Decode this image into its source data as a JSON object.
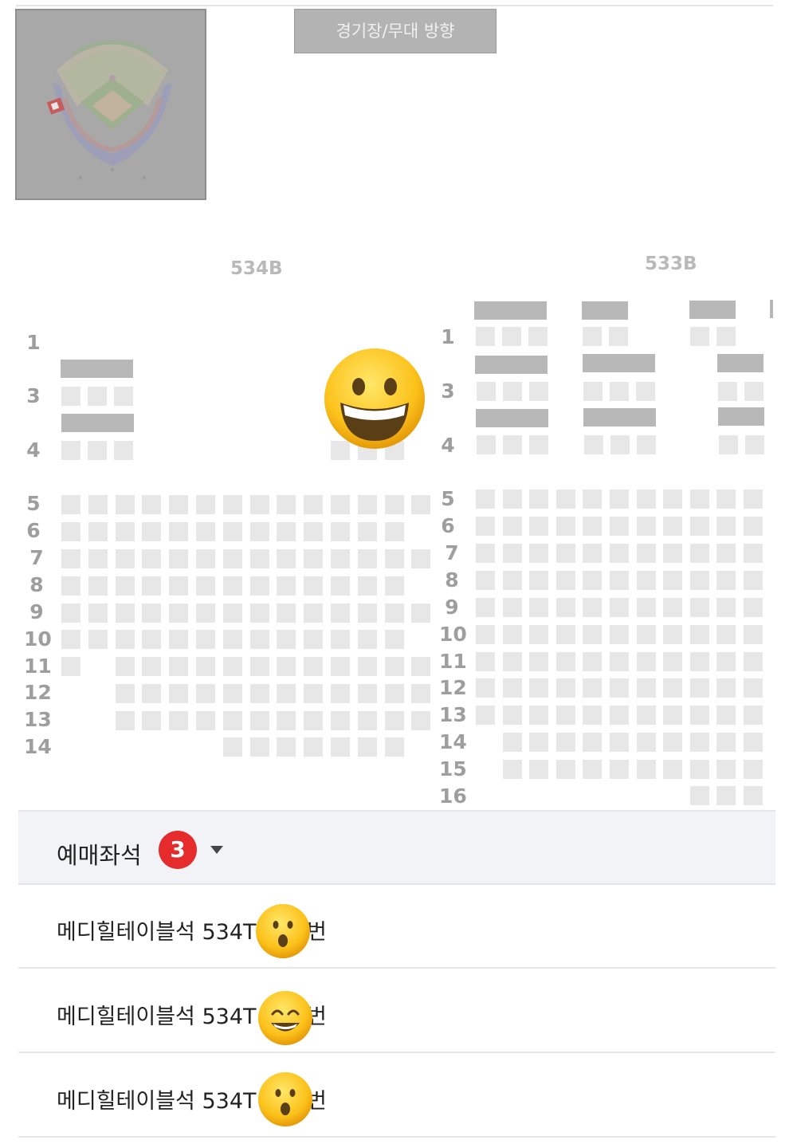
{
  "header": {
    "direction_label": "경기장/무대 방향"
  },
  "sections": [
    {
      "label": "534B"
    },
    {
      "label": "533B"
    }
  ],
  "left_rows": [
    "1",
    "3",
    "4",
    "5",
    "6",
    "7",
    "8",
    "9",
    "10",
    "11",
    "12",
    "13",
    "14"
  ],
  "right_rows": [
    "1",
    "3",
    "4",
    "5",
    "6",
    "7",
    "8",
    "9",
    "10",
    "11",
    "12",
    "13",
    "14",
    "15",
    "16"
  ],
  "booked": {
    "title": "예매좌석",
    "count": "3",
    "items": [
      {
        "text": "메디힐테이블석 534T",
        "suffix": "번"
      },
      {
        "text": "메디힐테이블석 534T",
        "suffix": "번"
      },
      {
        "text": "메디힐테이블석 534T",
        "suffix": "번"
      }
    ]
  },
  "colors": {
    "badge": "#e52b2b",
    "seat": "#e7e7e7",
    "seat_bar": "#b8b8b8"
  }
}
